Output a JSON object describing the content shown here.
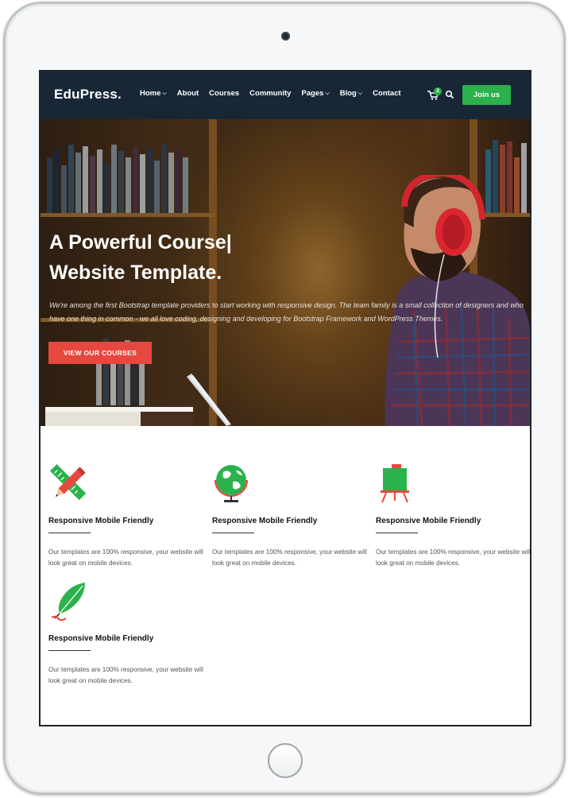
{
  "site": {
    "logo": "EduPress.",
    "nav": [
      {
        "label": "Home",
        "dropdown": true
      },
      {
        "label": "About",
        "dropdown": false
      },
      {
        "label": "Courses",
        "dropdown": false
      },
      {
        "label": "Community",
        "dropdown": false
      },
      {
        "label": "Pages",
        "dropdown": true
      },
      {
        "label": "Blog",
        "dropdown": true
      },
      {
        "label": "Contact",
        "dropdown": false
      }
    ],
    "cart_count": "2",
    "join_label": "Join us",
    "icons": {
      "cart": "cart-icon",
      "search": "search-icon"
    }
  },
  "hero": {
    "title_line1": "A Powerful Course|",
    "title_line2": "Website Template.",
    "subtitle": "We're among the first Bootstrap template providers to start working with responsive design. The team family is a small collection of designers and who have one thing in common - we all love coding, designing and developing for Bootstrap Framework and WordPress Themes.",
    "cta_label": "VIEW OUR COURSES"
  },
  "features": [
    {
      "icon": "pencil-ruler-icon",
      "title": "Responsive Mobile Friendly",
      "text": "Our templates are 100% responsive, your website will look great on mobile devices."
    },
    {
      "icon": "globe-icon",
      "title": "Responsive Mobile Friendly",
      "text": "Our templates are 100% responsive, your website will look great on mobile devices."
    },
    {
      "icon": "easel-board-icon",
      "title": "Responsive Mobile Friendly",
      "text": "Our templates are 100% responsive, your website will look great on mobile devices."
    },
    {
      "icon": "feather-quill-icon",
      "title": "Responsive Mobile Friendly",
      "text": "Our templates are 100% responsive, your website will look great on mobile devices."
    }
  ],
  "colors": {
    "header_bg": "#172736",
    "accent_green": "#2bb24c",
    "accent_red": "#e6473e"
  }
}
